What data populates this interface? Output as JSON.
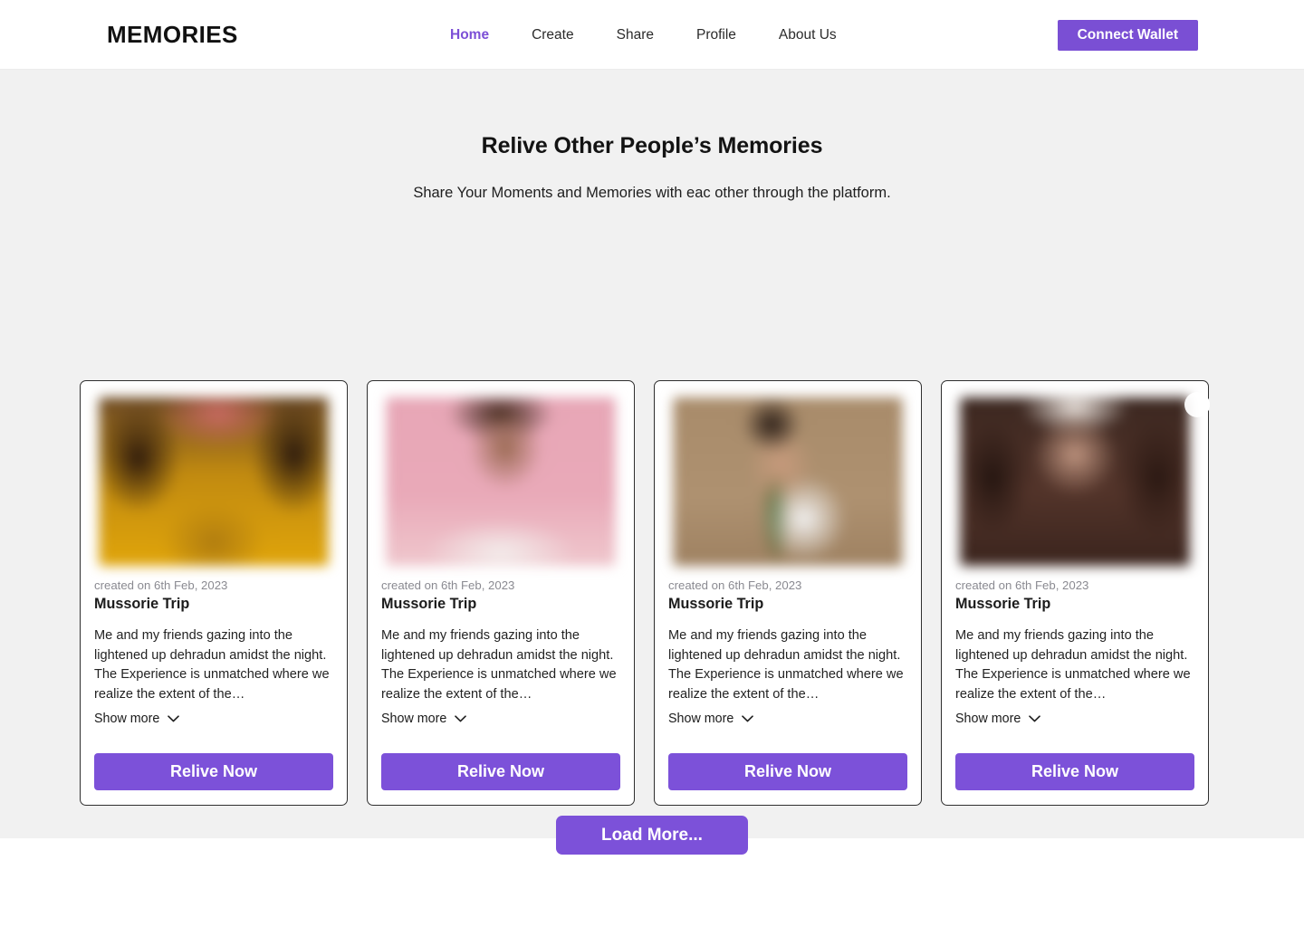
{
  "header": {
    "brand": "MEMORIES",
    "nav": [
      {
        "label": "Home",
        "active": true
      },
      {
        "label": "Create",
        "active": false
      },
      {
        "label": "Share",
        "active": false
      },
      {
        "label": "Profile",
        "active": false
      },
      {
        "label": "About Us",
        "active": false
      }
    ],
    "connect_wallet_label": "Connect Wallet",
    "accent_color": "#7a4fd4"
  },
  "hero": {
    "title": "Relive Other People’s Memories",
    "subtitle": "Share Your Moments and Memories with eac other through the platform."
  },
  "cards": [
    {
      "date": "created on 6th Feb, 2023",
      "title": "Mussorie Trip",
      "description": "Me and my  friends gazing into the lightened up dehradun amidst the night.  The Experience is unmatched where we realize the extent of the…",
      "show_more_label": "Show more",
      "action_label": "Relive Now",
      "avatar_icon": "avatar-circle-icon",
      "chevron_icon": "chevron-down-icon"
    },
    {
      "date": "created on 6th Feb, 2023",
      "title": "Mussorie Trip",
      "description": "Me and my  friends gazing into the lightened up dehradun amidst the night.  The Experience is unmatched where we realize the extent of the…",
      "show_more_label": "Show more",
      "action_label": "Relive Now",
      "avatar_icon": "avatar-circle-icon",
      "chevron_icon": "chevron-down-icon"
    },
    {
      "date": "created on 6th Feb, 2023",
      "title": "Mussorie Trip",
      "description": "Me and my  friends gazing into the lightened up dehradun amidst the night.  The Experience is unmatched where we realize the extent of the…",
      "show_more_label": "Show more",
      "action_label": "Relive Now",
      "avatar_icon": "avatar-circle-icon",
      "chevron_icon": "chevron-down-icon"
    },
    {
      "date": "created on 6th Feb, 2023",
      "title": "Mussorie Trip",
      "description": "Me and my  friends gazing into the lightened up dehradun amidst the night.  The Experience is unmatched where we realize the extent of the…",
      "show_more_label": "Show more",
      "action_label": "Relive Now",
      "avatar_icon": "avatar-circle-icon",
      "chevron_icon": "chevron-down-icon"
    }
  ],
  "footer": {
    "load_more_label": "Load More...",
    "button_color": "#7c51d9"
  }
}
